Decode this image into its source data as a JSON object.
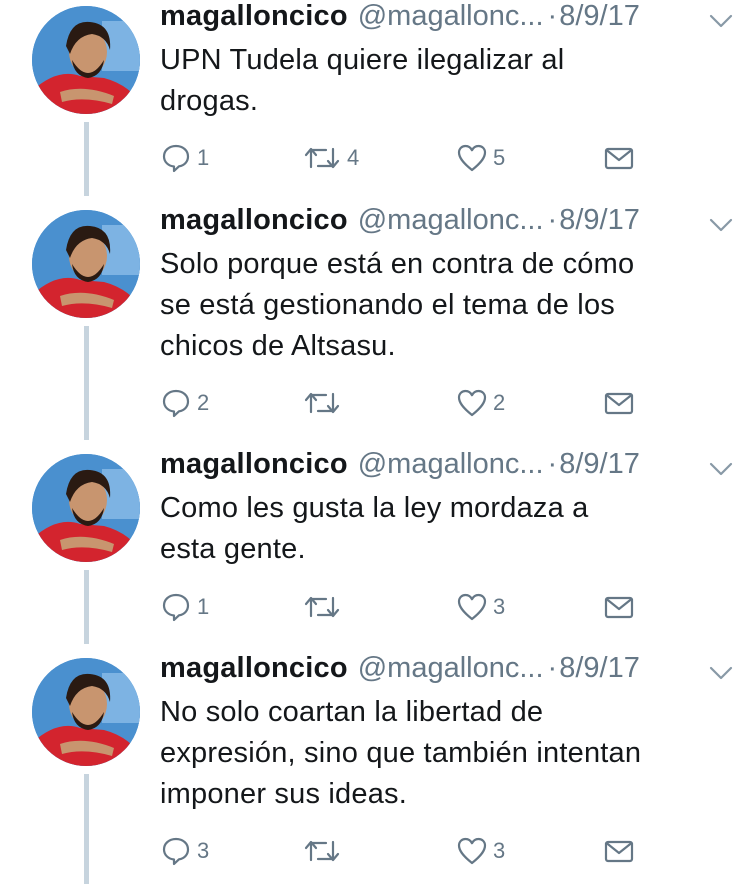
{
  "tweets": [
    {
      "name": "magalloncico",
      "handle": "@magallonc...",
      "dot": "·",
      "date": "8/9/17",
      "lines": [
        "UPN Tudela quiere ilegalizar al",
        "drogas."
      ],
      "replies": "1",
      "retweets": "4",
      "likes": "5"
    },
    {
      "name": "magalloncico",
      "handle": "@magallonc...",
      "dot": "·",
      "date": "8/9/17",
      "lines": [
        "Solo porque está en contra de cómo",
        "se está gestionando el tema de los",
        "chicos de Altsasu."
      ],
      "replies": "2",
      "retweets": "",
      "likes": "2"
    },
    {
      "name": "magalloncico",
      "handle": "@magallonc...",
      "dot": "·",
      "date": "8/9/17",
      "lines": [
        "Como les gusta la ley mordaza a",
        "esta gente."
      ],
      "replies": "1",
      "retweets": "",
      "likes": "3"
    },
    {
      "name": "magalloncico",
      "handle": "@magallonc...",
      "dot": "·",
      "date": "8/9/17",
      "lines": [
        "No solo coartan la libertad de",
        "expresión, sino que también intentan",
        "imponer sus ideas."
      ],
      "replies": "3",
      "retweets": "",
      "likes": "3"
    }
  ],
  "icons": {
    "reply": "reply-icon",
    "retweet": "retweet-icon",
    "like": "heart-icon",
    "dm": "envelope-icon",
    "caret": "chevron-down-icon"
  },
  "colors": {
    "text": "#14171a",
    "secondary": "#657786",
    "thread_line": "#c7d4de"
  }
}
